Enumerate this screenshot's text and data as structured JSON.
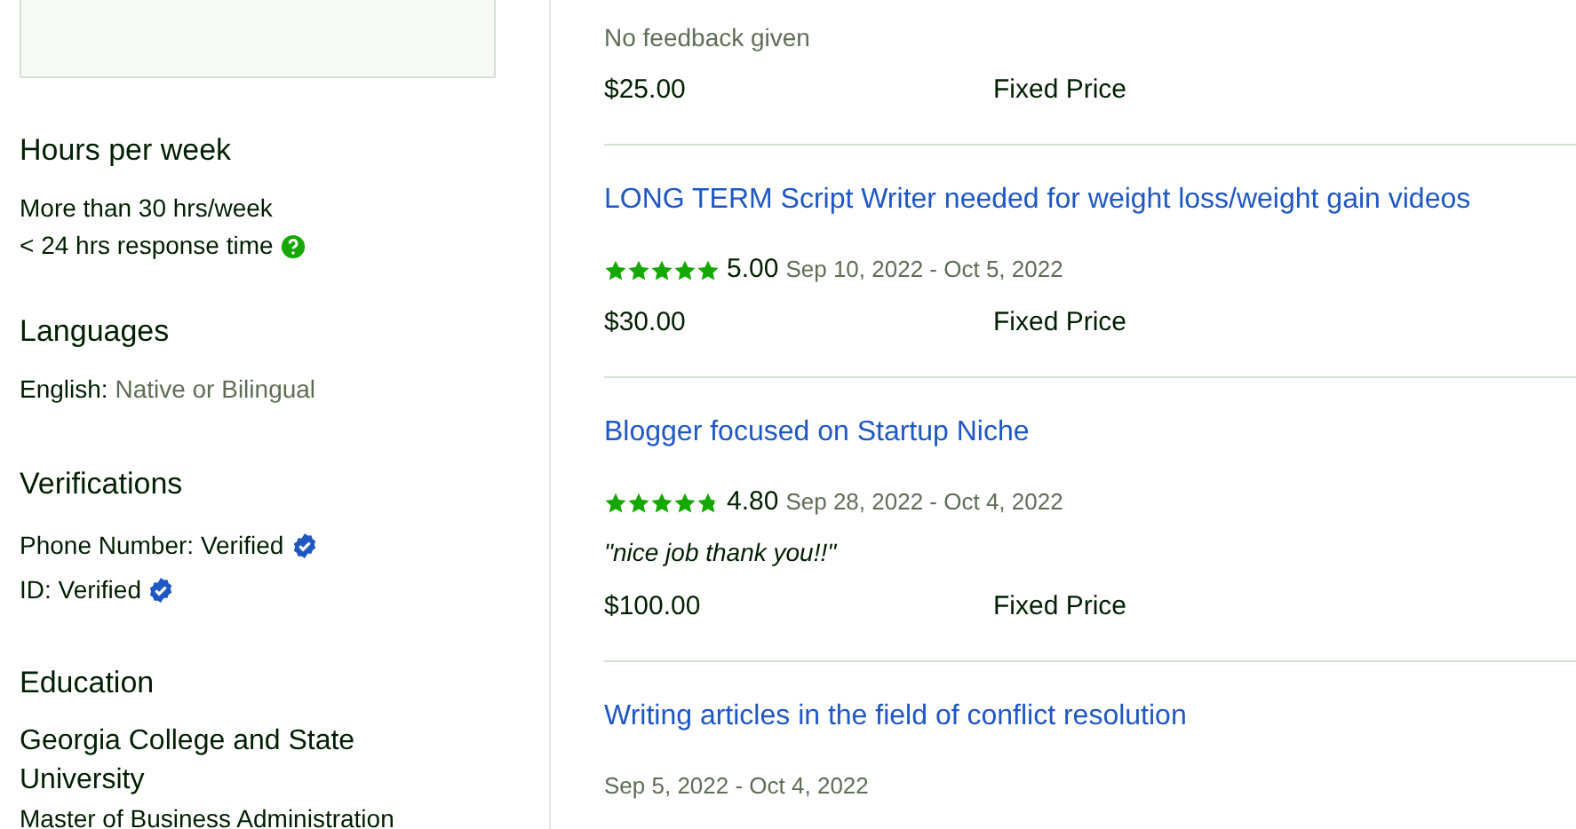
{
  "sidebar": {
    "sections": [
      {
        "kind": "hours",
        "heading": "Hours per week",
        "lines": [
          "More than 30 hrs/week"
        ],
        "response": "< 24 hrs response time"
      },
      {
        "kind": "languages",
        "heading": "Languages",
        "items": [
          {
            "label": "English:",
            "value": "Native or Bilingual"
          }
        ]
      },
      {
        "kind": "verifications",
        "heading": "Verifications",
        "items": [
          {
            "label": "Phone Number:",
            "value": "Verified",
            "verified": true
          },
          {
            "label": "ID:",
            "value": "Verified",
            "verified": true
          }
        ]
      },
      {
        "kind": "education",
        "heading": "Education",
        "school": "Georgia College and State University",
        "degree": "Master of Business Administration"
      }
    ]
  },
  "jobs": [
    {
      "feedback": {
        "kind": "none",
        "text": "No feedback given"
      },
      "price": "$25.00",
      "type": "Fixed Price"
    },
    {
      "title": "LONG TERM Script Writer needed for weight loss/weight gain videos",
      "stars": 5,
      "rating": "5.00",
      "dates": "Sep 10, 2022 - Oct 5, 2022",
      "price": "$30.00",
      "type": "Fixed Price"
    },
    {
      "title": "Blogger focused on Startup Niche",
      "stars": 4.8,
      "rating": "4.80",
      "dates": "Sep 28, 2022 - Oct 4, 2022",
      "feedback": {
        "kind": "quote",
        "text": "\"nice job thank you!!\""
      },
      "price": "$100.00",
      "type": "Fixed Price"
    },
    {
      "title": "Writing articles in the field of conflict resolution",
      "dates": "Sep 5, 2022 - Oct 4, 2022"
    }
  ]
}
